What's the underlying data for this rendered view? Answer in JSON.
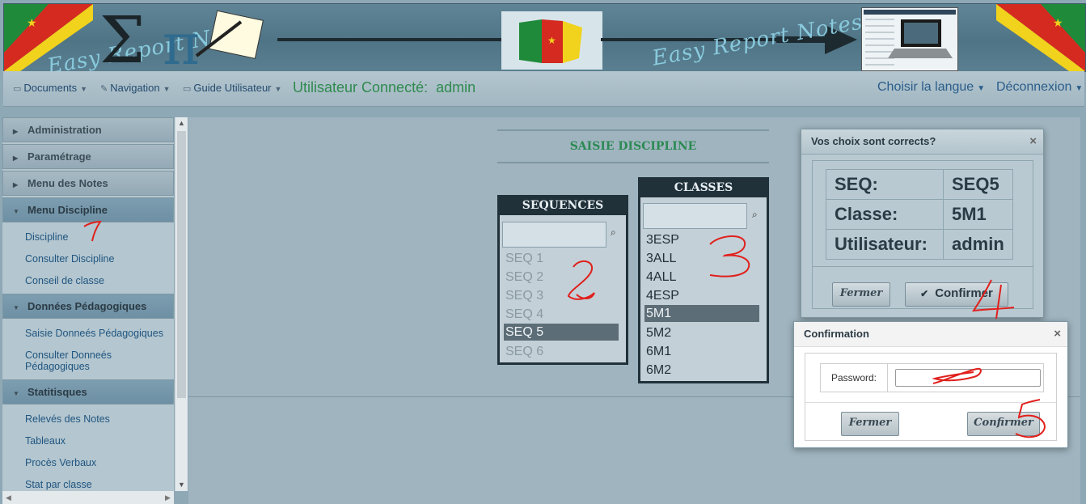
{
  "banner": {
    "title_left": "Easy Report Notes",
    "title_right": "Easy Report Notes"
  },
  "navbar": {
    "documents": "Documents",
    "navigation": "Navigation",
    "guide": "Guide Utilisateur",
    "user_label": "Utilisateur Connecté:",
    "user_value": "admin",
    "language": "Choisir la langue",
    "logout": "Déconnexion"
  },
  "sidebar": {
    "sections": [
      {
        "label": "Administration",
        "open": false,
        "items": []
      },
      {
        "label": "Paramétrage",
        "open": false,
        "items": []
      },
      {
        "label": "Menu des Notes",
        "open": false,
        "items": []
      },
      {
        "label": "Menu Discipline",
        "open": true,
        "items": [
          "Discipline",
          "Consulter Discipline",
          "Conseil de classe"
        ]
      },
      {
        "label": "Données Pédagogiques",
        "open": true,
        "items": [
          "Saisie Donneés Pédagogiques",
          "Consulter Donneés Pédagogiques"
        ]
      },
      {
        "label": "Statitisques",
        "open": true,
        "items": [
          "Relevés des Notes",
          "Tableaux",
          "Procès Verbaux",
          "Stat par classe"
        ]
      }
    ]
  },
  "main": {
    "page_title": "SAISIE DISCIPLINE",
    "sequences": {
      "title": "SEQUENCES",
      "search_placeholder": "",
      "options": [
        "SEQ 1",
        "SEQ 2",
        "SEQ 3",
        "SEQ 4",
        "SEQ 5",
        "SEQ 6"
      ],
      "selected": "SEQ 5"
    },
    "classes": {
      "title": "CLASSES",
      "search_placeholder": "",
      "options": [
        "3ESP",
        "3ALL",
        "4ALL",
        "4ESP",
        "5M1",
        "5M2",
        "6M1",
        "6M2"
      ],
      "selected": "5M1"
    }
  },
  "dialog_choices": {
    "title": "Vos choix sont corrects?",
    "rows": [
      {
        "label": "SEQ:",
        "value": "SEQ5"
      },
      {
        "label": "Classe:",
        "value": "5M1"
      },
      {
        "label": "Utilisateur:",
        "value": "admin"
      }
    ],
    "close_label": "Fermer",
    "confirm_label": "Confirmer"
  },
  "dialog_confirmation": {
    "title": "Confirmation",
    "password_label": "Password:",
    "password_value": "",
    "close_label": "Fermer",
    "confirm_label": "Confirmer"
  },
  "annotations": [
    "1",
    "2",
    "3",
    "4",
    "5"
  ],
  "colors": {
    "accent_green": "#2f8a4e",
    "link_blue": "#1f5580",
    "handwriting_red": "#e0201c"
  },
  "icons": [
    "document-icon",
    "pencil-icon",
    "search-icon",
    "check-icon",
    "close-icon",
    "caret-down-icon",
    "triangle-right-icon",
    "triangle-down-icon"
  ]
}
